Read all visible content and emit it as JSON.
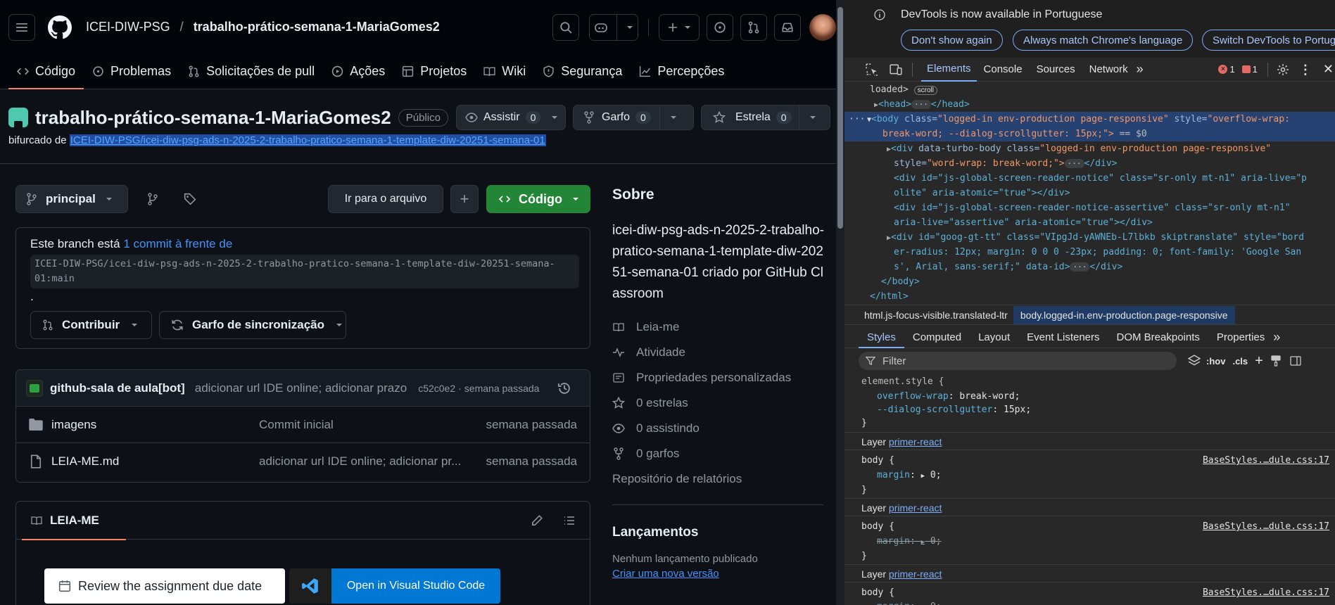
{
  "header": {
    "owner": "ICEI-DIW-PSG",
    "separator": "/",
    "repo": "trabalho-prático-semana-1-MariaGomes2"
  },
  "tabs": [
    {
      "label": "Código",
      "icon": "code-icon"
    },
    {
      "label": "Problemas",
      "icon": "issue-icon"
    },
    {
      "label": "Solicitações de pull",
      "icon": "pull-request-icon"
    },
    {
      "label": "Ações",
      "icon": "play-icon"
    },
    {
      "label": "Projetos",
      "icon": "table-icon"
    },
    {
      "label": "Wiki",
      "icon": "book-icon"
    },
    {
      "label": "Segurança",
      "icon": "shield-icon"
    },
    {
      "label": "Percepções",
      "icon": "graph-icon"
    }
  ],
  "repo": {
    "title": "trabalho-prático-semana-1-MariaGomes2",
    "visibility": "Público",
    "watch_label": "Assistir",
    "watch_count": "0",
    "fork_label": "Garfo",
    "fork_count": "0",
    "star_label": "Estrela",
    "star_count": "0",
    "forked_prefix": "bifurcado de",
    "forked_from": "ICEI-DIW-PSG/icei-diw-psg-ads-n-2025-2-trabalho-pratico-semana-1-template-diw-20251-semana-01"
  },
  "toolbar": {
    "branch": "principal",
    "goto_file": "Ir para o arquivo",
    "add": "+",
    "code_button": "Código"
  },
  "branch_box": {
    "text": "Este branch está",
    "link": "1 commit à frente de",
    "ref": "ICEI-DIW-PSG/icei-diw-psg-ads-n-2025-2-trabalho-pratico-semana-1-template-diw-20251-semana-01:main",
    "period": ".",
    "contribute": "Contribuir",
    "sync": "Garfo de sincronização"
  },
  "commit": {
    "author": "github-sala de aula[bot]",
    "message": "adicionar url IDE online; adicionar prazo",
    "hash": "c52c0e2",
    "sep": "·",
    "time": "semana passada"
  },
  "files": [
    {
      "name": "imagens",
      "icon": "folder-icon",
      "message": "Commit inicial",
      "time": "semana passada"
    },
    {
      "name": "LEIA-ME.md",
      "icon": "file-icon",
      "message": "adicionar url IDE online; adicionar pr...",
      "time": "semana passada"
    }
  ],
  "readme": {
    "tab": "LEIA-ME"
  },
  "about": {
    "heading": "Sobre",
    "description": "icei-diw-psg-ads-n-2025-2-trabalho-pratico-semana-1-template-diw-20251-semana-01 criado por GitHub Classroom",
    "items": [
      {
        "icon": "book-icon",
        "label": "Leia-me"
      },
      {
        "icon": "pulse-icon",
        "label": "Atividade"
      },
      {
        "icon": "note-icon",
        "label": "Propriedades personalizadas"
      },
      {
        "icon": "star-icon",
        "label": "0 estrelas"
      },
      {
        "icon": "eye-icon",
        "label": "0 assistindo"
      },
      {
        "icon": "fork-icon",
        "label": "0 garfos"
      }
    ],
    "report": "Repositório de relatórios",
    "releases_heading": "Lançamentos",
    "releases_none": "Nenhum lançamento publicado",
    "releases_create": "Criar uma nova versão"
  },
  "popup": {
    "review": "Review the assignment due date",
    "vscode": "Open in Visual Studio Code"
  },
  "devtools": {
    "notice": "DevTools is now available in Portuguese",
    "btn_dont_show": "Don't show again",
    "btn_match": "Always match Chrome's language",
    "btn_switch": "Switch DevTools to Portug",
    "tabs": [
      "Elements",
      "Console",
      "Sources",
      "Network"
    ],
    "error_count": "1",
    "warning_count": "1",
    "dom": {
      "loaded": "loaded>",
      "scroll_badge": "scroll",
      "head": "<head>",
      "head_close": "</head>",
      "body_open": "<body",
      "body_class_attr": "class=",
      "body_class_val": "\"logged-in env-production page-responsive\"",
      "body_style_attr": "style=",
      "body_style_val1": "\"overflow-wrap:",
      "body_style_val2": "break-word; --dialog-scrollgutter: 15px;\">",
      "body_eq": "== $0",
      "div1_a": "<div",
      "div1_attr1": "data-turbo-body",
      "div1_attr2": "class=",
      "div1_val2": "\"logged-in env-production page-responsive\"",
      "div1_line2_attr": "style=",
      "div1_line2_val": "\"word-wrap: break-word;\">",
      "div1_close": "</div>",
      "div2_line1": "<div id=\"js-global-screen-reader-notice\" class=\"sr-only mt-n1\" aria-live=\"p",
      "div2_line2": "olite\" aria-atomic=\"true\"></div>",
      "div3_line1": "<div id=\"js-global-screen-reader-notice-assertive\" class=\"sr-only mt-n1\"",
      "div3_line2": "aria-live=\"assertive\" aria-atomic=\"true\"></div>",
      "div4_line1": "<div id=\"goog-gt-tt\" class=\"VIpgJd-yAWNEb-L7lbkb skiptranslate\" style=\"bord",
      "div4_line2": "er-radius: 12px; margin: 0 0 0 -23px; padding: 0; font-family: 'Google San",
      "div4_line3": "s', Arial, sans-serif;\" data-id>",
      "div4_close": "</div>",
      "body_close": "</body>",
      "html_close": "</html>"
    },
    "crumbs": [
      "html.js-focus-visible.translated-ltr",
      "body.logged-in.env-production.page-responsive"
    ],
    "style_tabs": [
      "Styles",
      "Computed",
      "Layout",
      "Event Listeners",
      "DOM Breakpoints",
      "Properties"
    ],
    "filter": "Filter",
    "hov": ":hov",
    "cls": ".cls",
    "element_style": "element.style {",
    "rule1_prop": "overflow-wrap",
    "rule1_val": "break-word;",
    "rule2_prop": "--dialog-scrollgutter",
    "rule2_val": "15px;",
    "close_brace": "}",
    "layer_label": "Layer",
    "layer_link": "primer-react",
    "body_sel": "body {",
    "margin_prop": "margin",
    "margin_val": "0;",
    "source": "BaseStyles.…dule.css:17"
  }
}
